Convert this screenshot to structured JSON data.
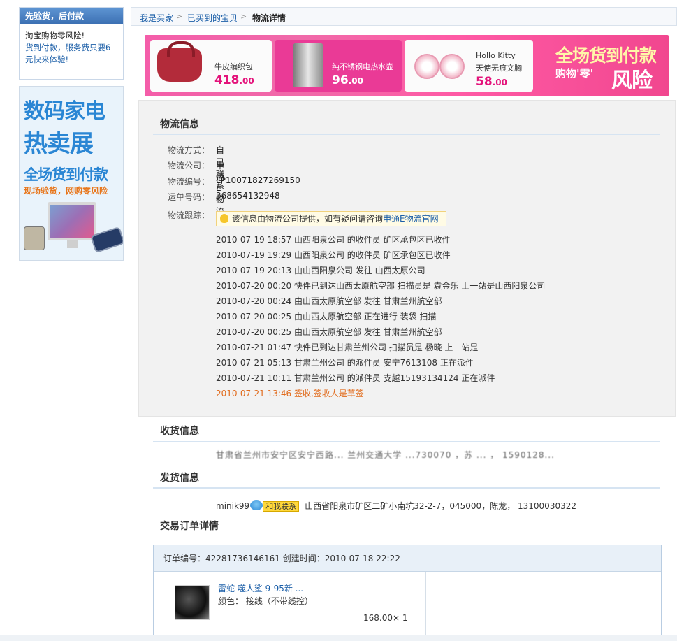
{
  "sidebar": {
    "promo_title": "先验货，后付款",
    "promo_line1": "淘宝购物零风险!",
    "promo_line2": "货到付款，服务费只要6元快来体验!",
    "ad_line1": "数码家电",
    "ad_line2": "热卖展",
    "ad_line3": "全场货到付款",
    "ad_line4": "现场验货，网购零风险"
  },
  "breadcrumb": {
    "items": [
      "我是买家",
      "已买到的宝贝",
      "物流详情"
    ],
    "separator": ">"
  },
  "banner": {
    "products": [
      {
        "name": "牛皮编织包",
        "price_int": "418",
        "price_dec": ".00"
      },
      {
        "name": "纯不锈钢电热水壶",
        "price_int": "96",
        "price_dec": ".00"
      },
      {
        "name": "Hollo Kitty\n天使无痕文胸",
        "name1": "Hollo Kitty",
        "name2": "天使无痕文胸",
        "price_int": "58",
        "price_dec": ".00"
      }
    ],
    "slogan_top": "全场货到付款",
    "slogan_left": "购物'零'",
    "slogan_right": "风险"
  },
  "logistics": {
    "title": "物流信息",
    "fields": [
      {
        "label": "物流方式：",
        "value": "自己联系"
      },
      {
        "label": "物流公司：",
        "value": "申通E物流"
      },
      {
        "label": "物流编号：",
        "value": "LP10071827269150"
      },
      {
        "label": "运单号码：",
        "value": "368654132948"
      }
    ],
    "tracking_label": "物流跟踪：",
    "notice_text": "该信息由物流公司提供，如有疑问请咨询",
    "notice_link": "申通E物流官网",
    "tracking": [
      "2010-07-19 18:57 山西阳泉公司 的收件员 矿区承包区已收件",
      "2010-07-19 19:29 山西阳泉公司 的收件员 矿区承包区已收件",
      "2010-07-19 20:13 由山西阳泉公司 发往 山西太原公司",
      "2010-07-20 00:20 快件已到达山西太原航空部 扫描员是 袁金乐 上一站是山西阳泉公司",
      "2010-07-20 00:24 由山西太原航空部 发往 甘肃兰州航空部",
      "2010-07-20 00:25 由山西太原航空部 正在进行 装袋 扫描",
      "2010-07-20 00:25 由山西太原航空部 发往 甘肃兰州航空部",
      "2010-07-21 01:47 快件已到达甘肃兰州公司 扫描员是 杨晓 上一站是",
      "2010-07-21 05:13 甘肃兰州公司 的派件员 安宁7613108 正在派件",
      "2010-07-21 10:11 甘肃兰州公司 的派件员 支越15193134124 正在派件",
      "2010-07-21 13:46 签收,签收人是草签"
    ]
  },
  "receiver": {
    "title": "收货信息",
    "blurred_text": "甘肃省兰州市安宁区安宁西路... 兰州交通大学 ...730070 ，苏 ... ，  1590128..."
  },
  "sender": {
    "title": "发货信息",
    "user": "minik99",
    "contact_label": "和我联系",
    "address": "山西省阳泉市矿区二矿小南坑32-2-7，045000，陈龙，  13100030322"
  },
  "order": {
    "title": "交易订单详情",
    "header": "订单编号：42281736146161   创建时间：2010-07-18 22:22",
    "item_name": "雷蛇 噬人鲨 9-95新 ...",
    "item_attr": "颜色：  接线（不带线控）",
    "item_price": "168.00× 1"
  },
  "colors": {
    "accent": "#1c5fa8",
    "banner_pink": "#f45da9",
    "signed_orange": "#e16b1c",
    "panel_bg": "#f2f2f2"
  }
}
